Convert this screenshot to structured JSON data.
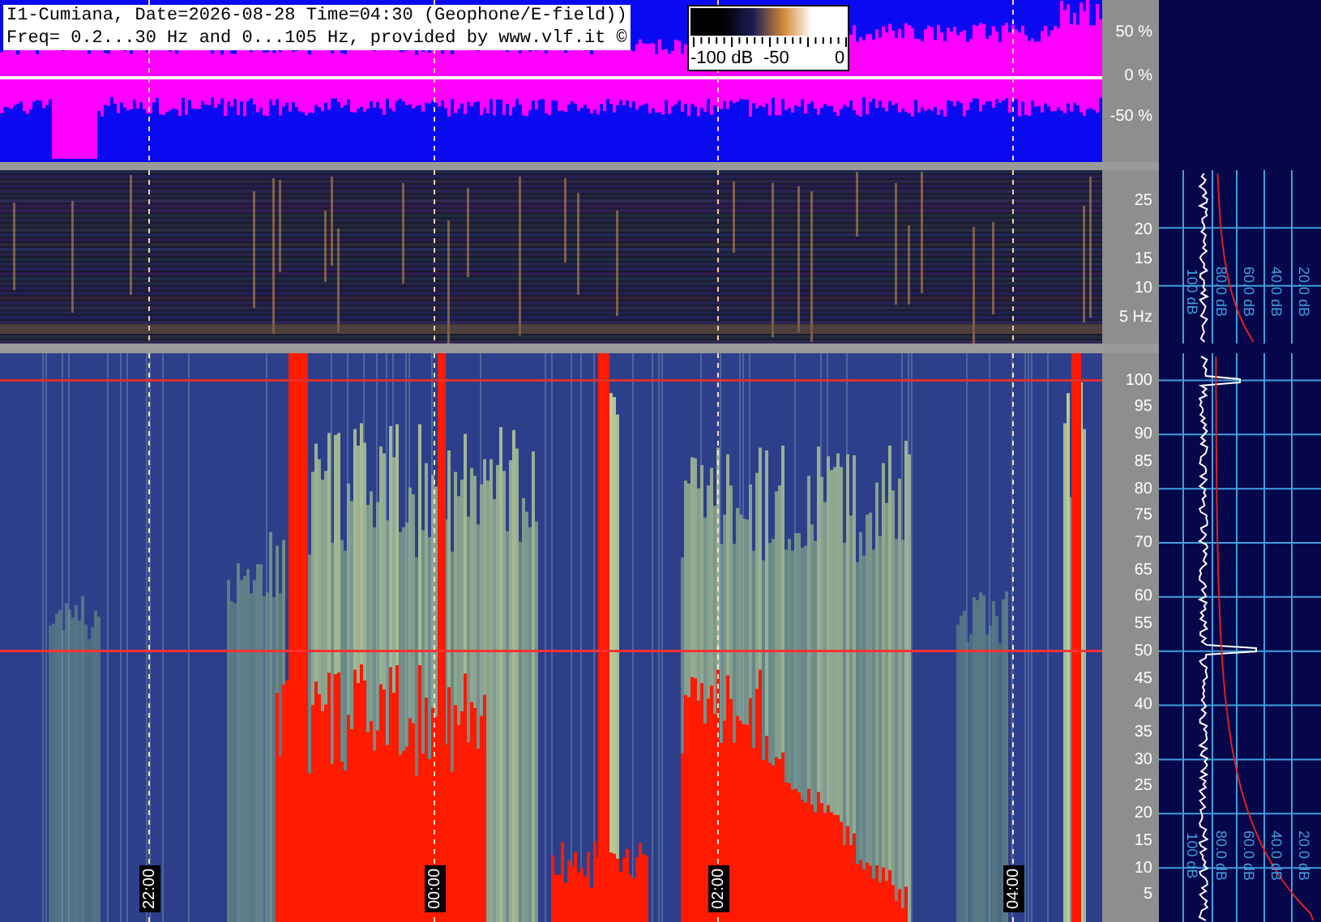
{
  "header": {
    "lines": [
      "I1-Cumiana, Date=2026-08-28 Time=04:30 (Geophone/E-field))",
      "Freq= 0.2...30 Hz and 0...105 Hz, provided by www.vlf.it ©"
    ]
  },
  "colorbar": {
    "labels": [
      "-100 dB",
      "-50",
      "0"
    ]
  },
  "waveform_axis": {
    "ticks": [
      "50 %",
      "0 %",
      "-50 %"
    ]
  },
  "low_band_axis": {
    "ticks": [
      "25",
      "20",
      "15",
      "10",
      "5 Hz"
    ]
  },
  "main_axis": {
    "ticks": [
      "100",
      "95",
      "90",
      "85",
      "80",
      "75",
      "70",
      "65",
      "60",
      "55",
      "50",
      "45",
      "40",
      "35",
      "30",
      "25",
      "20",
      "15",
      "10",
      "5"
    ]
  },
  "time_labels": [
    "22:00",
    "00:00",
    "02:00",
    "04:00"
  ],
  "low_band_profile": {
    "scale_labels": [
      "100 dB",
      "80.0 dB",
      "60.0 dB",
      "40.0 dB",
      "20.0 dB"
    ]
  },
  "main_profile": {
    "scale_labels": [
      "100 dB",
      "80.0 dB",
      "60.0 dB",
      "40.0 dB",
      "20.0 dB"
    ]
  }
}
